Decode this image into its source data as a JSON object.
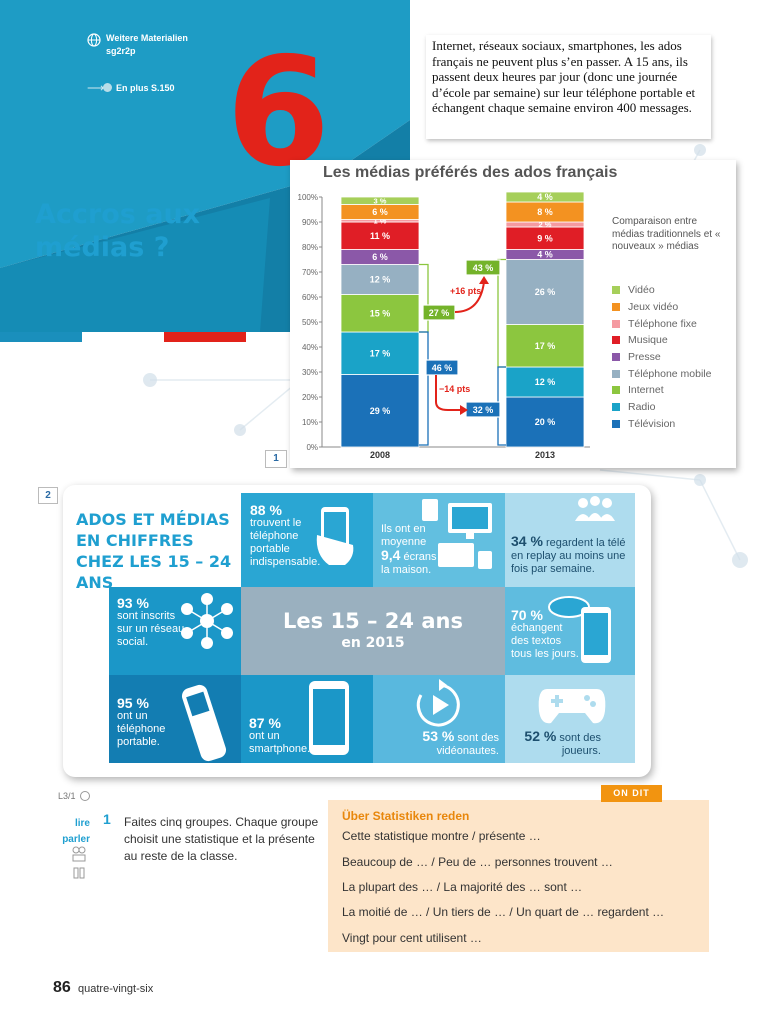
{
  "header": {
    "materials_label": "Weitere Materialien",
    "materials_code": "sg2r2p",
    "plus_link": "En plus S.150",
    "chapter_number": "6",
    "title": "Accros aux médias ?",
    "colors": {
      "band": "#1e9cc5",
      "band_dark": "#137fa7",
      "red": "#e2231a"
    }
  },
  "intro": {
    "text": "Internet, réseaux sociaux, smartphones, les ados français ne peuvent plus s’en passer. A 15 ans, ils passent deux heures par jour (donc une journée d’école par semaine) sur leur téléphone portable et échangent chaque semaine environ 400 messages."
  },
  "figure1": {
    "number": "1",
    "legend_caption": "Comparaison entre médias traditionnels et « nouveaux » médias",
    "callouts": {
      "internet_2008": "27 %",
      "internet_2013": "43 %",
      "internet_change": "+16 pts",
      "tv_2008": "46 %",
      "tv_2013": "32 %",
      "tv_change": "−14 pts"
    }
  },
  "chart_data": {
    "type": "bar",
    "title": "Les médias préférés des ados français",
    "categories": [
      "2008",
      "2013"
    ],
    "ylim": [
      0,
      100
    ],
    "y_ticks": [
      "0%",
      "10%",
      "20%",
      "30%",
      "40%",
      "50%",
      "60%",
      "70%",
      "80%",
      "90%",
      "100%"
    ],
    "stacked": true,
    "legend_position": "right",
    "series": [
      {
        "name": "Télévision",
        "color": "#1b71b8",
        "values": [
          29,
          20
        ],
        "labels": [
          "29 %",
          "20 %"
        ]
      },
      {
        "name": "Radio",
        "color": "#1aa3c8",
        "values": [
          17,
          12
        ],
        "labels": [
          "17 %",
          "12 %"
        ]
      },
      {
        "name": "Internet",
        "color": "#8cc63f",
        "values": [
          15,
          17
        ],
        "labels": [
          "15 %",
          "17 %"
        ]
      },
      {
        "name": "Téléphone mobile",
        "color": "#96b0c2",
        "values": [
          12,
          26
        ],
        "labels": [
          "12 %",
          "26 %"
        ]
      },
      {
        "name": "Presse",
        "color": "#8b58a8",
        "values": [
          6,
          4
        ],
        "labels": [
          "6 %",
          "4 %"
        ]
      },
      {
        "name": "Musique",
        "color": "#e01e26",
        "values": [
          11,
          9
        ],
        "labels": [
          "11 %",
          "9 %"
        ]
      },
      {
        "name": "Téléphone fixe",
        "color": "#f59aa1",
        "values": [
          1,
          2
        ],
        "labels": [
          "1 %",
          "2 %"
        ]
      },
      {
        "name": "Jeux vidéo",
        "color": "#f39221",
        "values": [
          6,
          8
        ],
        "labels": [
          "6 %",
          "8 %"
        ]
      },
      {
        "name": "Vidéo",
        "color": "#a6cf5a",
        "values": [
          3,
          4
        ],
        "labels": [
          "3 %",
          "4 %"
        ]
      }
    ],
    "legend_order": [
      "Vidéo",
      "Jeux vidéo",
      "Téléphone fixe",
      "Musique",
      "Presse",
      "Téléphone mobile",
      "Internet",
      "Radio",
      "Télévision"
    ]
  },
  "figure2": {
    "number": "2",
    "title": "ADOS ET MÉDIAS EN CHIFFRES CHEZ LES 15 – 24 ANS",
    "center_title": "Les 15 – 24 ans",
    "center_sub": "en 2015",
    "stats": {
      "phone_pct": "88 %",
      "phone_text": "trouvent le téléphone portable indispensable.",
      "screens_pre": "Ils ont en moyenne",
      "screens_value": "9,4",
      "screens_post": "écrans à la maison.",
      "replay_pct": "34 %",
      "replay_text": "regardent la télé en replay au moins une fois par semaine.",
      "social_pct": "93 %",
      "social_text": "sont inscrits sur un réseau social.",
      "texts_pct": "70 %",
      "texts_text": "échangent des textos tous les jours.",
      "mobile_pct": "95 %",
      "mobile_text": "ont un téléphone portable.",
      "smart_pct": "87 %",
      "smart_text": "ont un smartphone.",
      "video_pct": "53 %",
      "video_text": "sont des vidéonautes.",
      "game_pct": "52 %",
      "game_text": "sont des joueurs."
    }
  },
  "exercise": {
    "ref": "L3/1",
    "skill1": "lire",
    "skill2": "parler",
    "number": "1",
    "text": "Faites cinq groupes. Chaque groupe choisit une statistique et la présente au reste de la classe."
  },
  "ondit": {
    "tag": "ON DIT",
    "heading": "Über Statistiken reden",
    "phrases": [
      "Cette statistique montre / présente …",
      "Beaucoup de … / Peu de … personnes trouvent …",
      "La plupart des … / La majorité des … sont …",
      "La moitié de … / Un tiers de … / Un quart de … regardent …",
      "Vingt pour cent utilisent …"
    ]
  },
  "footer": {
    "page_number": "86",
    "page_word": "quatre-vingt-six"
  }
}
